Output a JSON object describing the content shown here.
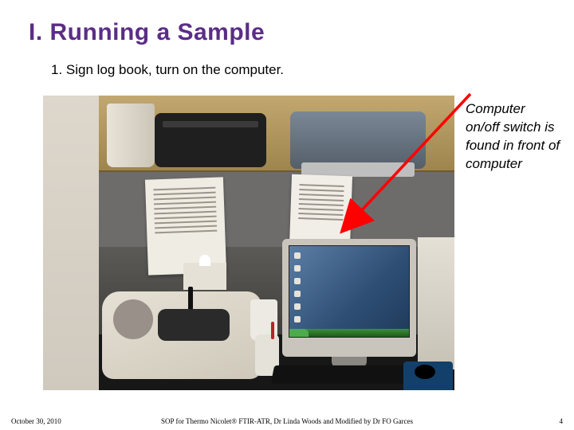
{
  "title": "I.  Running a Sample",
  "step": "1.  Sign log book,  turn on the computer.",
  "callout": "Computer on/off switch is found in front of computer",
  "footer": {
    "date": "October 30, 2010",
    "center": "SOP for Thermo Nicolet® FTIR-ATR,  Dr Linda Woods and Modified by Dr FO Garces",
    "page": "4"
  }
}
